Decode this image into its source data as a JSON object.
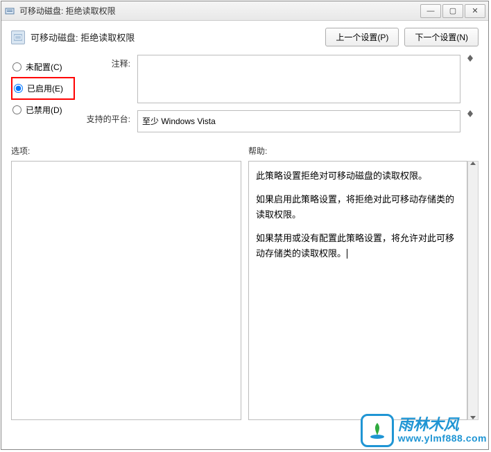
{
  "window": {
    "title": "可移动磁盘: 拒绝读取权限"
  },
  "header": {
    "title": "可移动磁盘: 拒绝读取权限",
    "prev_button": "上一个设置(P)",
    "next_button": "下一个设置(N)"
  },
  "radios": {
    "not_configured": "未配置(C)",
    "enabled": "已启用(E)",
    "disabled": "已禁用(D)",
    "selected": "enabled"
  },
  "fields": {
    "comment_label": "注释:",
    "comment_value": "",
    "platform_label": "支持的平台:",
    "platform_value": "至少 Windows Vista"
  },
  "lower": {
    "options_label": "选项:",
    "help_label": "帮助:",
    "options_content": "",
    "help_paragraphs": [
      "此策略设置拒绝对可移动磁盘的读取权限。",
      "如果启用此策略设置，将拒绝对此可移动存储类的读取权限。",
      "如果禁用或没有配置此策略设置，将允许对此可移动存储类的读取权限。"
    ]
  },
  "watermark": {
    "cn": "雨林木风",
    "url": "www.ylmf888.com"
  }
}
